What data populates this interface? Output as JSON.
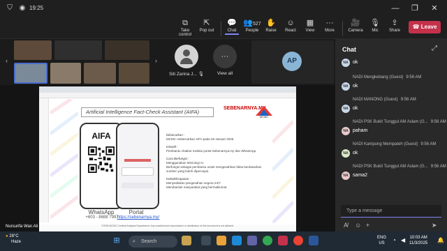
{
  "titlebar": {
    "timer": "19:25"
  },
  "toolbar": {
    "take_control": "Take control",
    "pop_out": "Pop out",
    "chat": "Chat",
    "people": "People",
    "people_count": "527",
    "raise": "Raise",
    "react": "React",
    "view": "View",
    "more": "More",
    "camera": "Camera",
    "mic": "Mic",
    "share": "Share",
    "leave": "Leave"
  },
  "participants": {
    "siti": "Siti Zarina J...",
    "view_all": "View all",
    "ap_initials": "AP"
  },
  "shared": {
    "slide_title": "Artificial Intelligence Fact-Check Assistant (AIFA)",
    "logo_text": "SEBENARNYA.MY",
    "logo2_text": "MCMC",
    "aifa": "AIFA",
    "cap_whatsapp": "WhatsApp",
    "cap_whatsapp_num": "+603 - 8688 7997",
    "cap_portal": "Portal",
    "cap_portal_url": "https://sebenarnya.my/",
    "p1h": "Dilancarkan :",
    "p1": "MCMC melancarkan AIFA pada 28 Januari 2025.",
    "p2h": "Inisiatif :",
    "p2": "Pembantu chatbot melalui portal Sebenarnya.my dan WhatsApp.",
    "p3h": "Cara Berfungsi :",
    "p3a": "Menggunakan teknologi AI.",
    "p3b": "Berfungsi sebagai pembantu untuk mengesahkan fakta berdasarkan sumber yang boleh dipercayai.",
    "p4h": "Kebolehcapaian :",
    "p4a": "Menyediakan pengesahan segera 24/7.",
    "p4b": "Membantuk masyarakat yang bermaklumat.",
    "footer": "©2025 MCMC Content Analysis Department. Any unauthorized reproduction or distribution of this document is not allowed.",
    "presenter": "Nursurifa Wan Ali"
  },
  "chat": {
    "title": "Chat",
    "messages": [
      {
        "initials": "NA",
        "name": "",
        "time": "",
        "text": "ok"
      },
      {
        "initials": "NA",
        "name": "NADI Mengkebang (Guest)",
        "time": "9:56 AM",
        "text": "ok"
      },
      {
        "initials": "NA",
        "name": "NADI MANONG (Guest)",
        "time": "9:56 AM",
        "text": "ok"
      },
      {
        "initials": "NA",
        "name": "NADI PSK Bukit Tunggul AM Aslam (G...",
        "time": "9:56 AM",
        "text": "paham"
      },
      {
        "initials": "NA",
        "name": "NADI Kampung Mempateh (Guest)",
        "time": "9:56 AM",
        "text": "ok"
      },
      {
        "initials": "NA",
        "name": "NADI PSK Bukit Tunggul AM Aslam (G...",
        "time": "9:56 AM",
        "text": "sama2"
      }
    ],
    "placeholder": "Type a message"
  },
  "taskbar": {
    "temp": "28°C",
    "weather": "Haze",
    "search": "Search",
    "lang1": "ENG",
    "lang2": "US",
    "time": "10:03 AM",
    "date": "11/3/2025"
  }
}
